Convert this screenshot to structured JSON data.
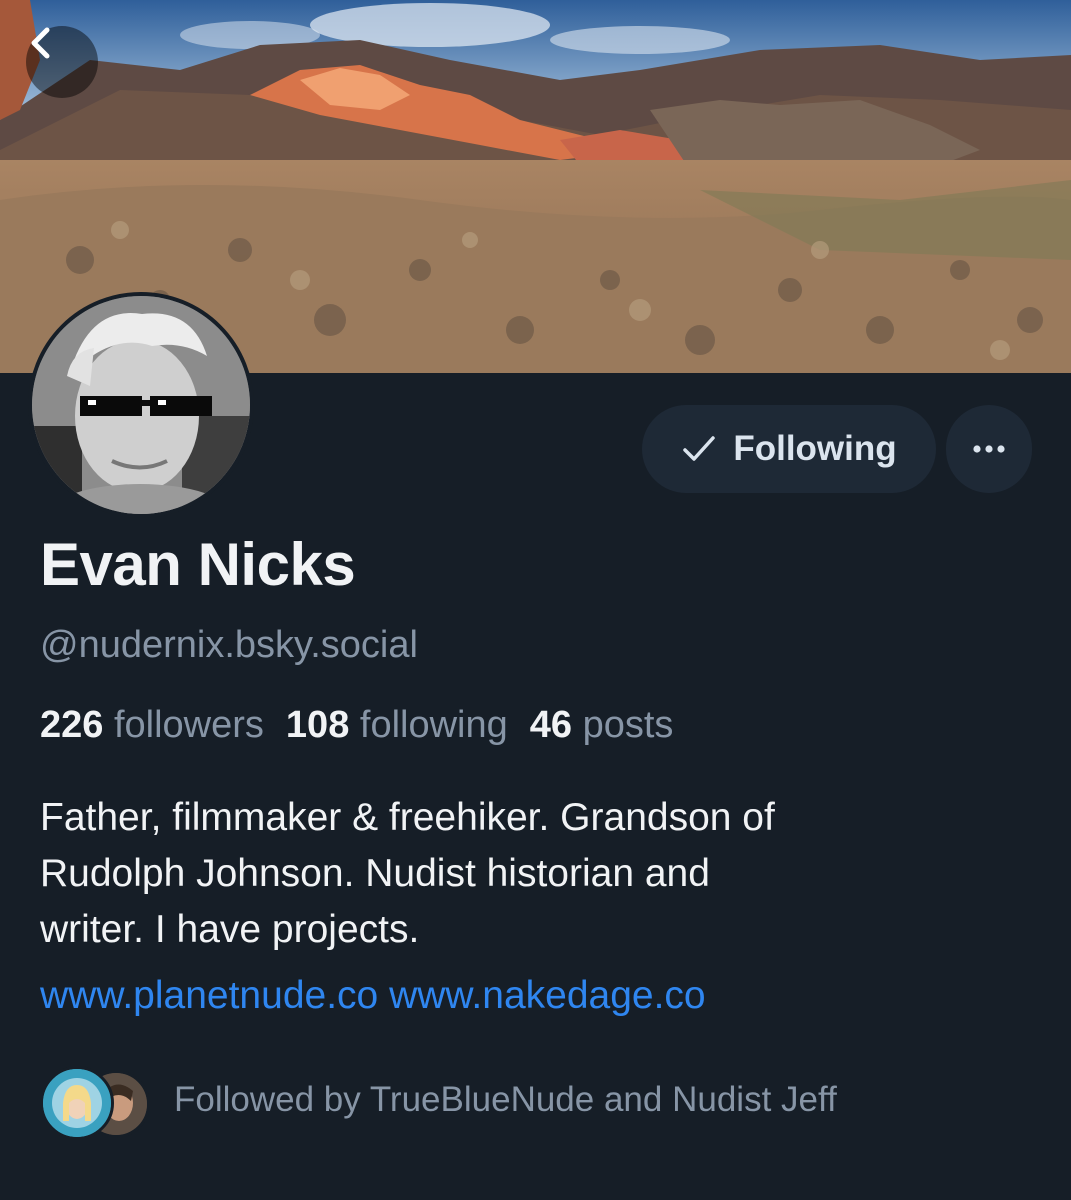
{
  "header": {
    "back_icon": "chevron-left-icon"
  },
  "profile": {
    "name": "Evan Nicks",
    "handle": "@nudernix.bsky.social",
    "following_button_label": "Following",
    "following_icon": "check-icon",
    "more_icon": "ellipsis-icon"
  },
  "stats": {
    "followers_count": "226",
    "followers_label": "followers",
    "following_count": "108",
    "following_label": "following",
    "posts_count": "46",
    "posts_label": "posts"
  },
  "bio": {
    "line1": "Father, filmmaker & freehiker. Grandson of",
    "line2": "Rudolph Johnson. Nudist historian and",
    "line3": "writer. I have projects.",
    "link1": "www.planetnude.co",
    "link2": "www.nakedage.co"
  },
  "followed_by": {
    "text": "Followed by TrueBlueNude and Nudist Jeff"
  },
  "colors": {
    "background": "#161e27",
    "button_bg": "#1e2936",
    "link": "#2f86f0",
    "muted_text": "#8795a6",
    "primary_text": "#f1f3f5"
  }
}
